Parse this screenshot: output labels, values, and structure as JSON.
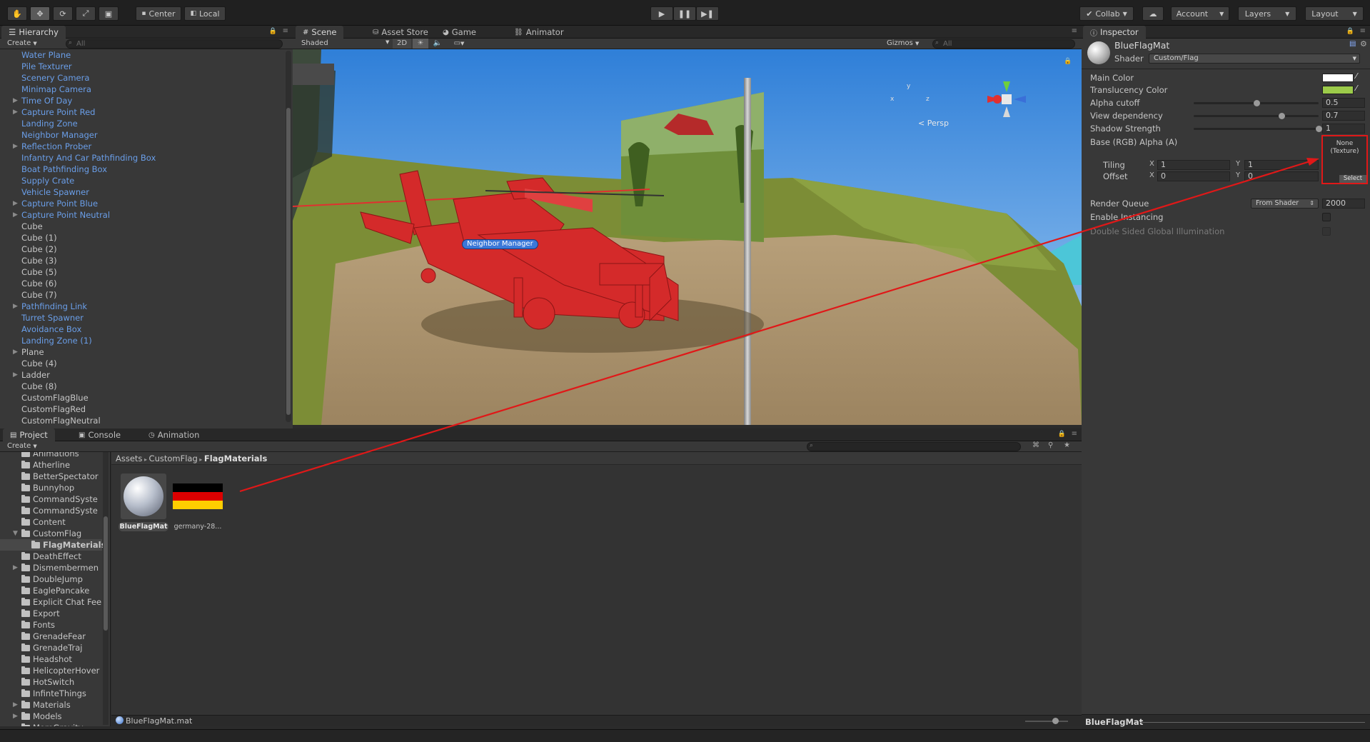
{
  "toolbar": {
    "center_label": "Center",
    "local_label": "Local",
    "collab_label": "Collab",
    "account_label": "Account",
    "layers_label": "Layers",
    "layout_label": "Layout"
  },
  "hierarchy": {
    "tab_label": "Hierarchy",
    "create_label": "Create",
    "search_placeholder": "All",
    "items": [
      {
        "label": "Water Plane",
        "prefab": true,
        "arrow": false
      },
      {
        "label": "Pile Texturer",
        "prefab": true,
        "arrow": false
      },
      {
        "label": "Scenery Camera",
        "prefab": true,
        "arrow": false
      },
      {
        "label": "Minimap Camera",
        "prefab": true,
        "arrow": false
      },
      {
        "label": "Time Of Day",
        "prefab": true,
        "arrow": true
      },
      {
        "label": "Capture Point Red",
        "prefab": true,
        "arrow": true
      },
      {
        "label": "Landing Zone",
        "prefab": true,
        "arrow": false
      },
      {
        "label": "Neighbor Manager",
        "prefab": true,
        "arrow": false
      },
      {
        "label": "Reflection Prober",
        "prefab": true,
        "arrow": true
      },
      {
        "label": "Infantry And Car Pathfinding Box",
        "prefab": true,
        "arrow": false
      },
      {
        "label": "Boat Pathfinding Box",
        "prefab": true,
        "arrow": false
      },
      {
        "label": "Supply Crate",
        "prefab": true,
        "arrow": false
      },
      {
        "label": "Vehicle Spawner",
        "prefab": true,
        "arrow": false
      },
      {
        "label": "Capture Point Blue",
        "prefab": true,
        "arrow": true
      },
      {
        "label": "Capture Point Neutral",
        "prefab": true,
        "arrow": true
      },
      {
        "label": "Cube",
        "prefab": false,
        "arrow": false
      },
      {
        "label": "Cube (1)",
        "prefab": false,
        "arrow": false
      },
      {
        "label": "Cube (2)",
        "prefab": false,
        "arrow": false
      },
      {
        "label": "Cube (3)",
        "prefab": false,
        "arrow": false
      },
      {
        "label": "Cube (5)",
        "prefab": false,
        "arrow": false
      },
      {
        "label": "Cube (6)",
        "prefab": false,
        "arrow": false
      },
      {
        "label": "Cube (7)",
        "prefab": false,
        "arrow": false
      },
      {
        "label": "Pathfinding Link",
        "prefab": true,
        "arrow": true
      },
      {
        "label": "Turret Spawner",
        "prefab": true,
        "arrow": false
      },
      {
        "label": "Avoidance Box",
        "prefab": true,
        "arrow": false
      },
      {
        "label": "Landing Zone (1)",
        "prefab": true,
        "arrow": false
      },
      {
        "label": "Plane",
        "prefab": false,
        "arrow": true
      },
      {
        "label": "Cube (4)",
        "prefab": false,
        "arrow": false
      },
      {
        "label": "Ladder",
        "prefab": false,
        "arrow": true
      },
      {
        "label": "Cube (8)",
        "prefab": false,
        "arrow": false
      },
      {
        "label": "CustomFlagBlue",
        "prefab": false,
        "arrow": false
      },
      {
        "label": "CustomFlagRed",
        "prefab": false,
        "arrow": false
      },
      {
        "label": "CustomFlagNeutral",
        "prefab": false,
        "arrow": false
      }
    ]
  },
  "scene": {
    "tabs": [
      "Scene",
      "Asset Store",
      "Game",
      "Animator"
    ],
    "shaded_label": "Shaded",
    "mode_2d_label": "2D",
    "gizmos_label": "Gizmos",
    "search_placeholder": "All",
    "persp_label": "Persp",
    "axis_y": "y",
    "axis_x": "x",
    "axis_z": "z",
    "selection_label": "Neighbor Manager"
  },
  "project": {
    "tabs": [
      "Project",
      "Console",
      "Animation"
    ],
    "create_label": "Create",
    "breadcrumb": [
      "Assets",
      "CustomFlag",
      "FlagMaterials"
    ],
    "tree": [
      {
        "label": "Animations",
        "indent": 0,
        "arrow": false
      },
      {
        "label": "Atherline",
        "indent": 0,
        "arrow": false
      },
      {
        "label": "BetterSpectator",
        "indent": 0,
        "arrow": false
      },
      {
        "label": "Bunnyhop",
        "indent": 0,
        "arrow": false
      },
      {
        "label": "CommandSyste",
        "indent": 0,
        "arrow": false
      },
      {
        "label": "CommandSyste",
        "indent": 0,
        "arrow": false
      },
      {
        "label": "Content",
        "indent": 0,
        "arrow": false
      },
      {
        "label": "CustomFlag",
        "indent": 0,
        "arrow": true
      },
      {
        "label": "FlagMaterials",
        "indent": 1,
        "arrow": false,
        "selected": true
      },
      {
        "label": "DeathEffect",
        "indent": 0,
        "arrow": false
      },
      {
        "label": "Dismembermen",
        "indent": 0,
        "arrow": true
      },
      {
        "label": "DoubleJump",
        "indent": 0,
        "arrow": false
      },
      {
        "label": "EaglePancake",
        "indent": 0,
        "arrow": false
      },
      {
        "label": "Explicit Chat Fee",
        "indent": 0,
        "arrow": false
      },
      {
        "label": "Export",
        "indent": 0,
        "arrow": false
      },
      {
        "label": "Fonts",
        "indent": 0,
        "arrow": false
      },
      {
        "label": "GrenadeFear",
        "indent": 0,
        "arrow": false
      },
      {
        "label": "GrenadeTraj",
        "indent": 0,
        "arrow": false
      },
      {
        "label": "Headshot",
        "indent": 0,
        "arrow": false
      },
      {
        "label": "HelicopterHover",
        "indent": 0,
        "arrow": false
      },
      {
        "label": "HotSwitch",
        "indent": 0,
        "arrow": false
      },
      {
        "label": "InfinteThings",
        "indent": 0,
        "arrow": false
      },
      {
        "label": "Materials",
        "indent": 0,
        "arrow": true
      },
      {
        "label": "Models",
        "indent": 0,
        "arrow": true
      },
      {
        "label": "MoreGravity",
        "indent": 0,
        "arrow": false
      }
    ],
    "assets": [
      {
        "label": "BlueFlagMat",
        "selected": true
      },
      {
        "label": "germany-28..."
      }
    ],
    "status_file": "BlueFlagMat.mat"
  },
  "inspector": {
    "tab_label": "Inspector",
    "material_name": "BlueFlagMat",
    "shader_label": "Shader",
    "shader_value": "Custom/Flag",
    "main_color_label": "Main Color",
    "translucency_label": "Translucency Color",
    "alpha_cutoff_label": "Alpha cutoff",
    "alpha_cutoff_value": "0.5",
    "alpha_cutoff_level": 0.5,
    "view_dependency_label": "View dependency",
    "view_dependency_value": "0.7",
    "view_dependency_level": 0.7,
    "shadow_strength_label": "Shadow Strength",
    "shadow_strength_value": "1",
    "shadow_strength_level": 1.0,
    "base_label": "Base (RGB) Alpha (A)",
    "texture_none": "None",
    "texture_type": "(Texture)",
    "texture_select": "Select",
    "tiling_label": "Tiling",
    "offset_label": "Offset",
    "x_label": "X",
    "y_label": "Y",
    "tiling_x": "1",
    "tiling_y": "1",
    "offset_x": "0",
    "offset_y": "0",
    "render_queue_label": "Render Queue",
    "render_queue_mode": "From Shader",
    "render_queue_value": "2000",
    "instancing_label": "Enable Instancing",
    "dsgi_label": "Double Sided Global Illumination",
    "footer_label": "BlueFlagMat",
    "main_color": "#ffffff",
    "translucency_color": "#9ccb4a",
    "highlight_color": "#e01818"
  }
}
